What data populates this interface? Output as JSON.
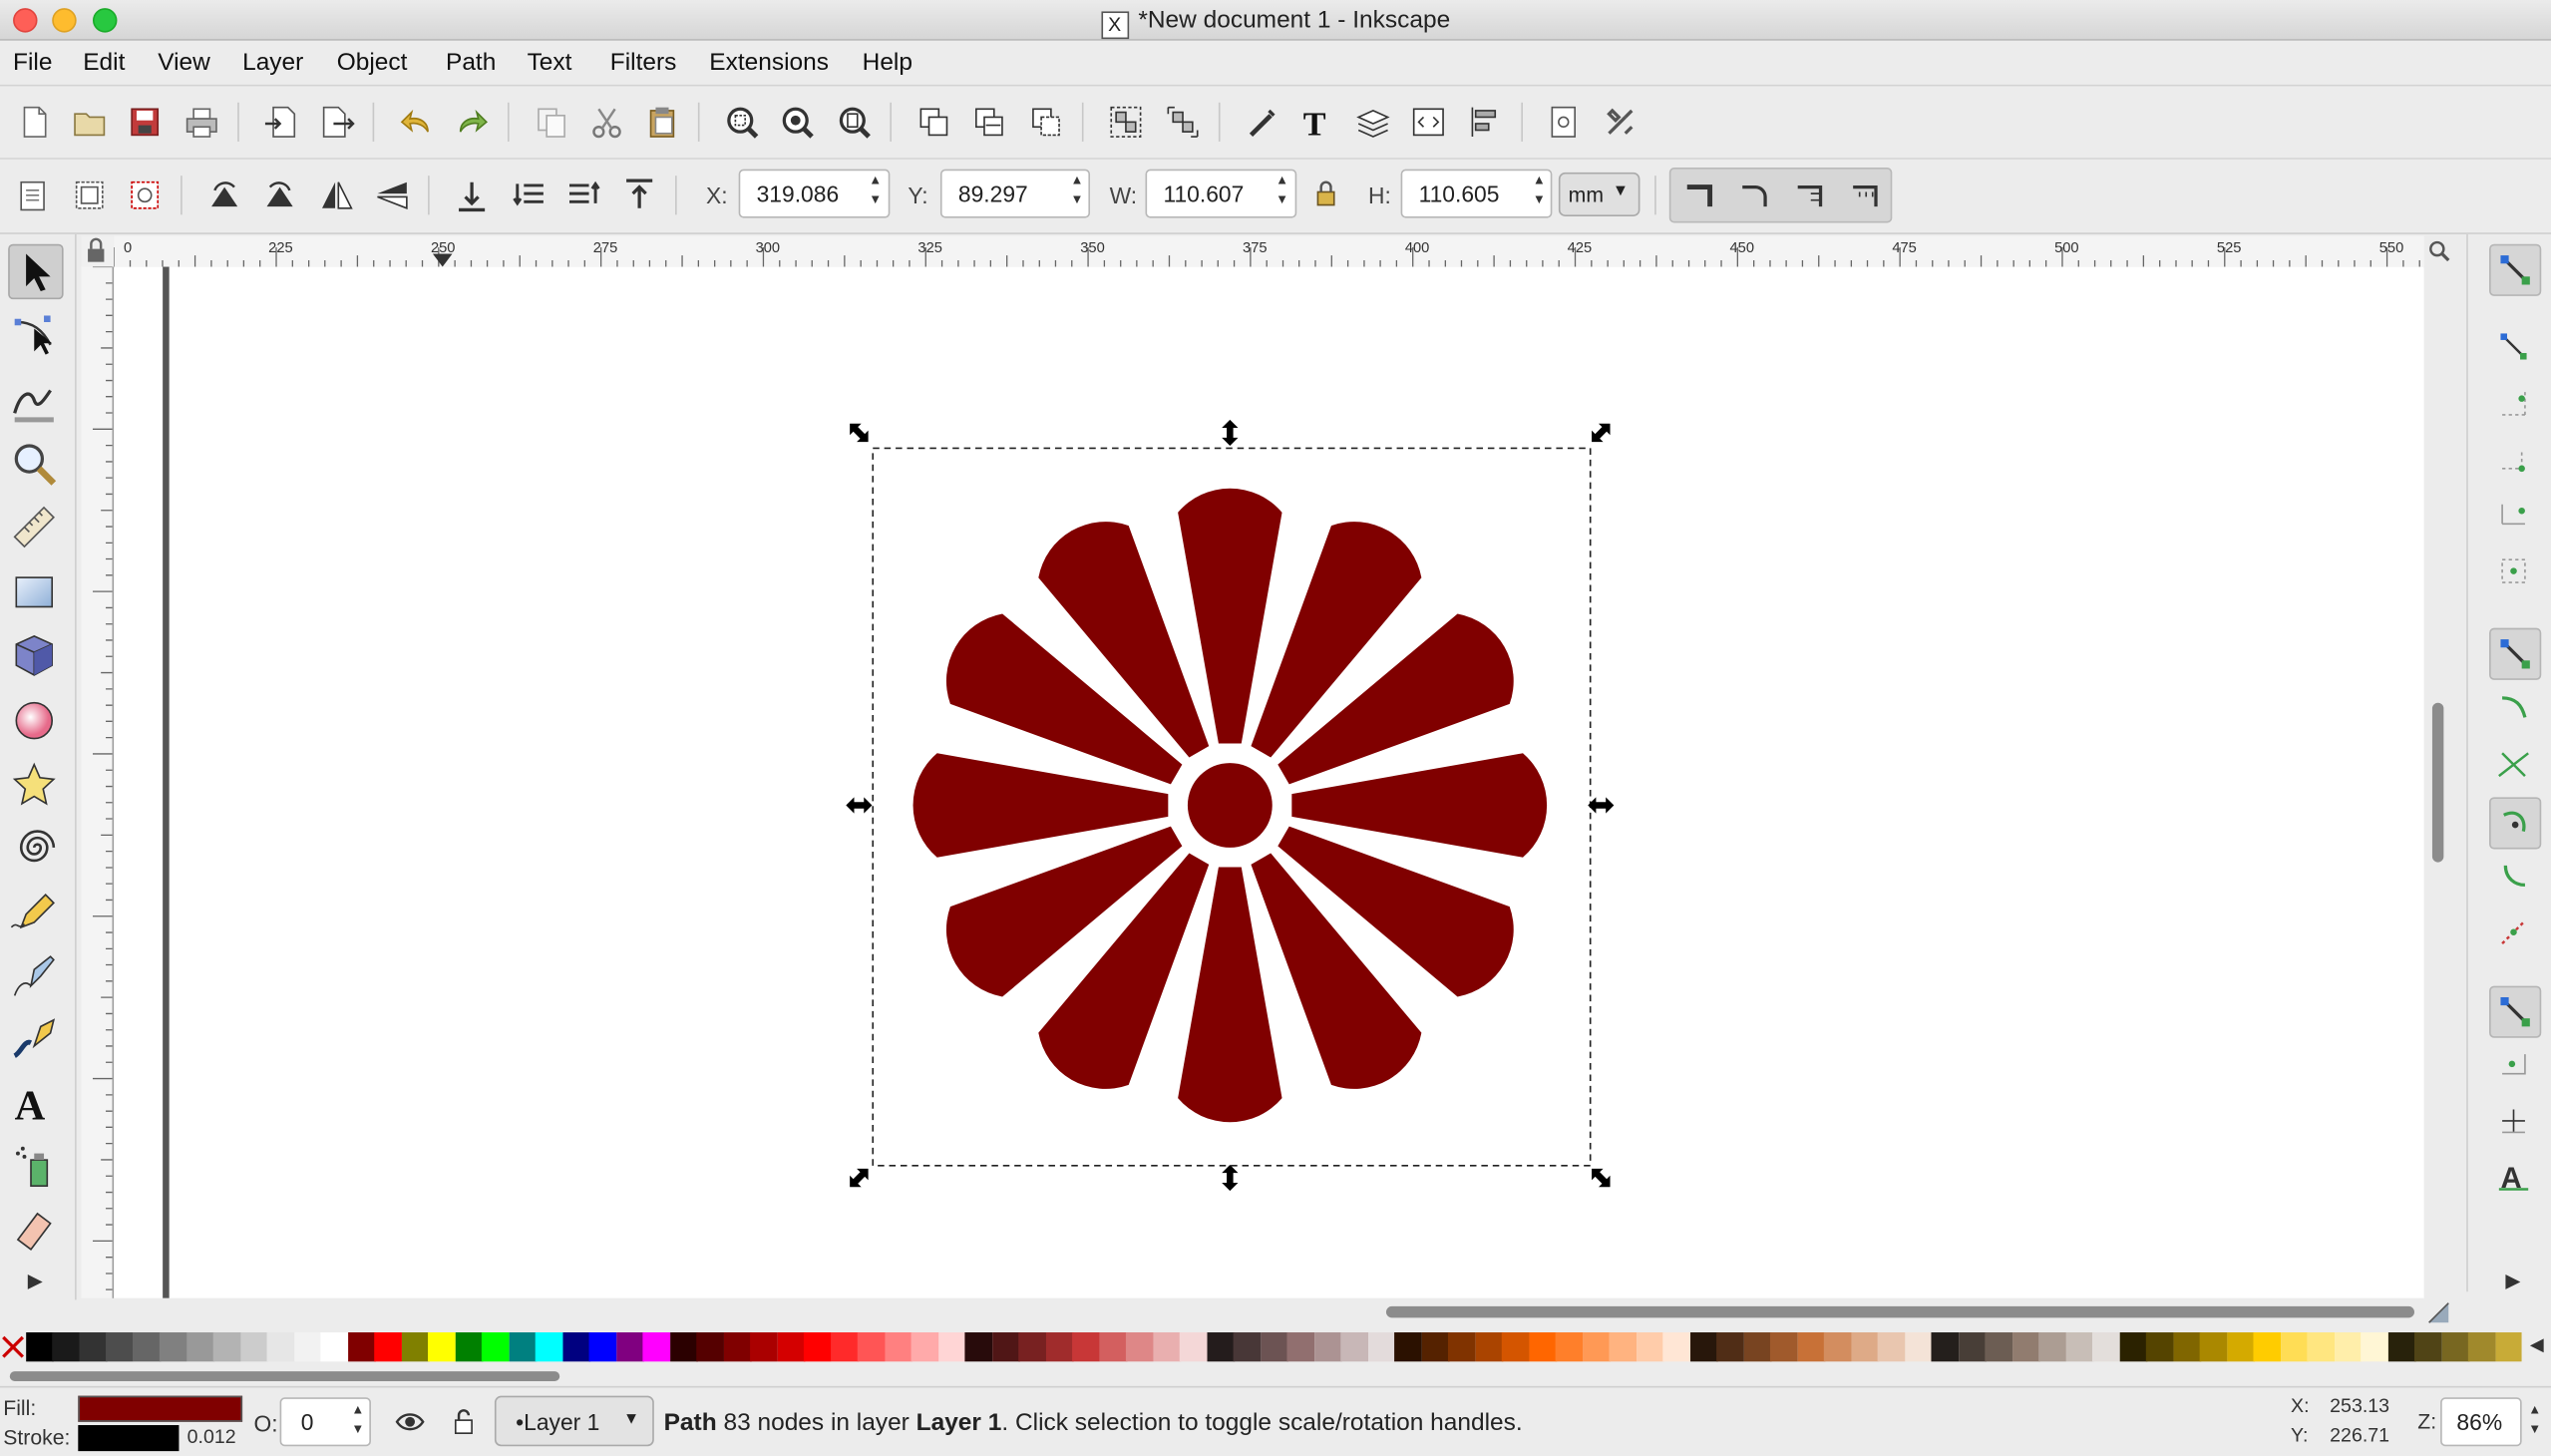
{
  "window": {
    "title": "*New document 1 - Inkscape",
    "x11_glyph": "X"
  },
  "menu": [
    "File",
    "Edit",
    "View",
    "Layer",
    "Object",
    "Path",
    "Text",
    "Filters",
    "Extensions",
    "Help"
  ],
  "toolbar": {
    "x_label": "X:",
    "x_value": "319.086",
    "y_label": "Y:",
    "y_value": "89.297",
    "w_label": "W:",
    "w_value": "110.607",
    "h_label": "H:",
    "h_value": "110.605",
    "unit": "mm"
  },
  "ruler": {
    "top_ticks": [
      "0",
      "225",
      "250",
      "275",
      "300",
      "325",
      "350",
      "375",
      "400",
      "425",
      "450",
      "475",
      "500",
      "525",
      "550"
    ]
  },
  "canvas": {
    "shape_fill": "#800000",
    "petal_count": 12
  },
  "palette": {
    "colors": [
      "#000000",
      "#1a1a1a",
      "#333333",
      "#4d4d4d",
      "#666666",
      "#808080",
      "#999999",
      "#b3b3b3",
      "#cccccc",
      "#e6e6e6",
      "#f2f2f2",
      "#ffffff",
      "#800000",
      "#ff0000",
      "#808000",
      "#ffff00",
      "#008000",
      "#00ff00",
      "#008080",
      "#00ffff",
      "#000080",
      "#0000ff",
      "#800080",
      "#ff00ff",
      "#2b0000",
      "#550000",
      "#800000",
      "#aa0000",
      "#d40000",
      "#ff0000",
      "#ff2a2a",
      "#ff5555",
      "#ff8080",
      "#ffaaaa",
      "#ffd5d5",
      "#280b0b",
      "#501616",
      "#782121",
      "#a02c2c",
      "#c83737",
      "#d35f5f",
      "#de8787",
      "#e9afaf",
      "#f4d7d7",
      "#241c1c",
      "#483737",
      "#6c5353",
      "#916f6f",
      "#ac9393",
      "#c8b7b7",
      "#e3dbdb",
      "#2b1100",
      "#552200",
      "#803300",
      "#aa4400",
      "#d45500",
      "#ff6600",
      "#ff7f2a",
      "#ff9955",
      "#ffb380",
      "#ffccaa",
      "#ffe6d5",
      "#28170b",
      "#502d16",
      "#784421",
      "#a05a2c",
      "#c87137",
      "#d38d5f",
      "#deaa87",
      "#e9c6af",
      "#f4e3d7",
      "#241f1c",
      "#483e37",
      "#6c5d53",
      "#917c6f",
      "#ac9d93",
      "#c8beb7",
      "#e3dedb",
      "#2b2200",
      "#554400",
      "#806600",
      "#aa8800",
      "#d4aa00",
      "#ffcc00",
      "#ffdd55",
      "#ffe680",
      "#ffeeaa",
      "#fff6d5",
      "#28220b",
      "#504416",
      "#786721",
      "#a0892c",
      "#c8ab37"
    ]
  },
  "status": {
    "fill_label": "Fill:",
    "stroke_label": "Stroke:",
    "stroke_width": "0.012",
    "fill_color": "#800000",
    "stroke_color": "#000000",
    "opacity_label": "O:",
    "opacity_value": "0",
    "layer_name": "•Layer 1",
    "message_bold1": "Path",
    "message_mid": " 83 nodes in layer ",
    "message_bold2": "Layer 1",
    "message_end": ". Click selection to toggle scale/rotation handles.",
    "cursor_x_label": "X:",
    "cursor_x": "253.13",
    "cursor_y_label": "Y:",
    "cursor_y": "226.71",
    "zoom_label": "Z:",
    "zoom_value": "86%"
  }
}
